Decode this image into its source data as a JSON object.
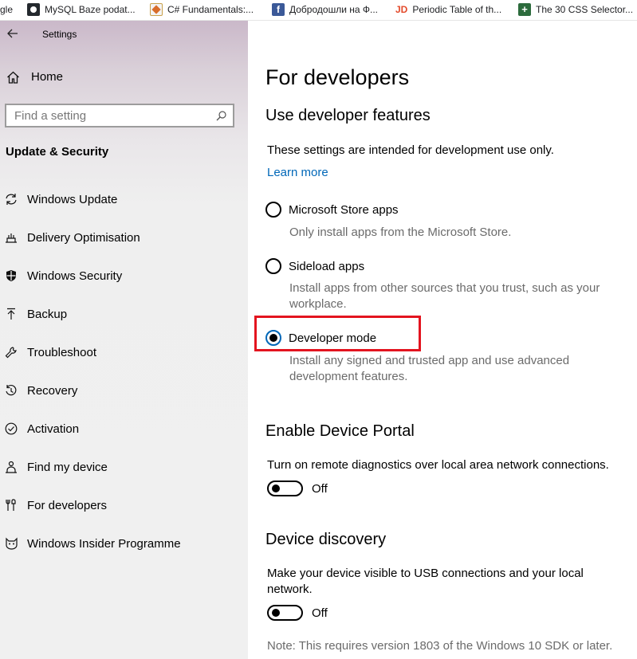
{
  "bookmarks": [
    {
      "label": "gle",
      "icon": "partial-icon"
    },
    {
      "label": "MySQL Baze podat...",
      "icon": "github-icon"
    },
    {
      "label": "C# Fundamentals:...",
      "icon": "codesmart-icon"
    },
    {
      "label": "Добродошли на Ф...",
      "icon": "facebook-icon"
    },
    {
      "label": "Periodic Table of th...",
      "icon": "jd-icon"
    },
    {
      "label": "The 30 CSS Selector...",
      "icon": "css-icon"
    }
  ],
  "window": {
    "title": "Settings"
  },
  "sidebar": {
    "home_label": "Home",
    "search_placeholder": "Find a setting",
    "section_title": "Update & Security",
    "items": [
      {
        "label": "Windows Update",
        "icon": "sync-icon"
      },
      {
        "label": "Delivery Optimisation",
        "icon": "delivery-icon"
      },
      {
        "label": "Windows Security",
        "icon": "shield-icon"
      },
      {
        "label": "Backup",
        "icon": "backup-arrow-icon"
      },
      {
        "label": "Troubleshoot",
        "icon": "wrench-icon"
      },
      {
        "label": "Recovery",
        "icon": "recovery-icon"
      },
      {
        "label": "Activation",
        "icon": "check-circle-icon"
      },
      {
        "label": "Find my device",
        "icon": "person-location-icon"
      },
      {
        "label": "For developers",
        "icon": "developer-tools-icon"
      },
      {
        "label": "Windows Insider Programme",
        "icon": "insider-cat-icon"
      }
    ]
  },
  "main": {
    "title": "For developers",
    "dev_features": {
      "heading": "Use developer features",
      "intro": "These settings are intended for development use only.",
      "learn_more": "Learn more",
      "options": [
        {
          "label": "Microsoft Store apps",
          "description": "Only install apps from the Microsoft Store.",
          "selected": false
        },
        {
          "label": "Sideload apps",
          "description": "Install apps from other sources that you trust, such as your workplace.",
          "selected": false
        },
        {
          "label": "Developer mode",
          "description": "Install any signed and trusted app and use advanced development features.",
          "selected": true
        }
      ]
    },
    "device_portal": {
      "heading": "Enable Device Portal",
      "description": "Turn on remote diagnostics over local area network connections.",
      "toggle_state": "Off"
    },
    "device_discovery": {
      "heading": "Device discovery",
      "description": "Make your device visible to USB connections and your local network.",
      "toggle_state": "Off",
      "note": "Note: This requires version 1803 of the Windows 10 SDK or later."
    }
  },
  "colors": {
    "accent": "#0067b8",
    "highlight_border": "#e3141f",
    "secondary_text": "#6b6b6b"
  }
}
